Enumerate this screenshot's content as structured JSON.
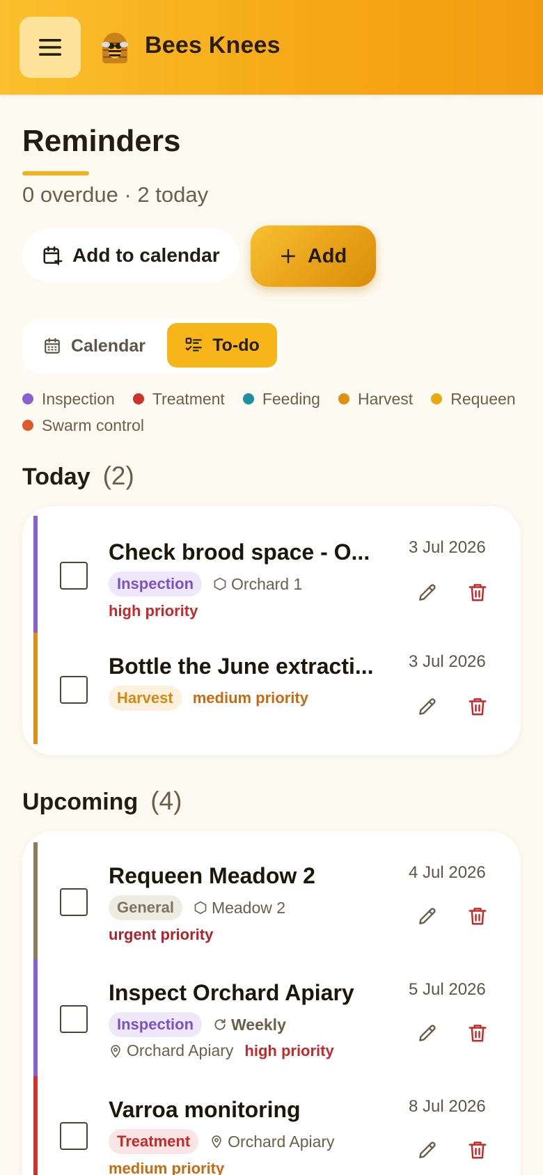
{
  "header": {
    "app_title": "Bees Knees",
    "menu_icon": "hamburger-icon",
    "logo_icon": "bee-logo-icon"
  },
  "page": {
    "title": "Reminders",
    "summary": "0 overdue · 2 today",
    "add_calendar_label": "Add to calendar",
    "add_label": "Add"
  },
  "view_toggle": {
    "calendar_label": "Calendar",
    "todo_label": "To-do",
    "selected": "To-do"
  },
  "legend": [
    {
      "label": "Inspection",
      "color": "#8a5fd0"
    },
    {
      "label": "Treatment",
      "color": "#d0312d"
    },
    {
      "label": "Feeding",
      "color": "#1f8fa0"
    },
    {
      "label": "Harvest",
      "color": "#df8f12"
    },
    {
      "label": "Requeen",
      "color": "#e8a90c"
    },
    {
      "label": "Swarm control",
      "color": "#e0592a"
    }
  ],
  "today": {
    "heading": "Today",
    "count": "(2)",
    "items": [
      {
        "title": "Check brood space - O...",
        "tag": "Inspection",
        "location": "Orchard 1",
        "priority": "high priority",
        "date": "3 Jul 2026",
        "color": "#8a5fd0"
      },
      {
        "title": "Bottle the June extracti...",
        "tag": "Harvest",
        "priority": "medium priority",
        "date": "3 Jul 2026",
        "color": "#df8f12"
      }
    ]
  },
  "upcoming": {
    "heading": "Upcoming",
    "count": "(4)",
    "items": [
      {
        "title": "Requeen Meadow 2",
        "tag": "General",
        "location": "Meadow 2",
        "priority": "urgent priority",
        "date": "4 Jul 2026",
        "color": "#8b7d5c"
      },
      {
        "title": "Inspect Orchard Apiary",
        "tag": "Inspection",
        "recurrence": "Weekly",
        "location": "Orchard Apiary",
        "priority": "high priority",
        "date": "5 Jul 2026",
        "color": "#8a5fd0"
      },
      {
        "title": "Varroa monitoring",
        "tag": "Treatment",
        "location": "Orchard Apiary",
        "priority": "medium priority",
        "date": "8 Jul 2026",
        "color": "#d0312d"
      }
    ]
  }
}
